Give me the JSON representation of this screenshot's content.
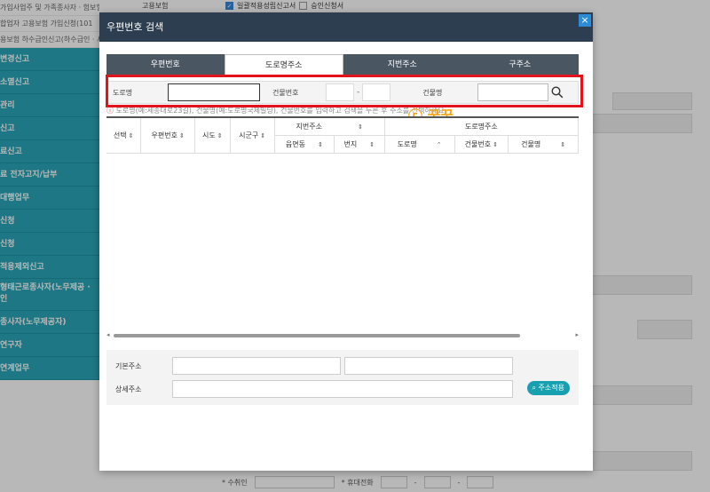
{
  "background": {
    "top_label": "고용보험",
    "checkbox1_label": "일괄적용성립신고서",
    "checkbox2_label": "승인신청서",
    "sidebar_subs": [
      "가입사업주 및 가족종사자 · 험보험가입신청(10108)",
      "합업자 고용보험 가입신청(101",
      "용보험 하수급인신고(하수급인 · 서)(10111)"
    ],
    "sidebar_items": [
      "변경신고",
      "소멸신고",
      "관리",
      "신고",
      "료신고",
      "료 전자고지/납부",
      "대행업무",
      "신청",
      "신청",
      "적용제외신고",
      "형태근로종사자(노무제공 · 인",
      "종사자(노무제공자)",
      "연구자",
      "연계업무"
    ],
    "bottom": {
      "label1": "* 수취인",
      "label2": "* 휴대전화",
      "dash": "-"
    }
  },
  "modal": {
    "title": "우편번호 검색",
    "close_icon": "×",
    "tabs": [
      "우편번호",
      "도로명주소",
      "지번주소",
      "구주소"
    ],
    "active_tab": 1,
    "search": {
      "road_label": "도로명",
      "road_value": "",
      "building_no_label": "건물번호",
      "dash": "-",
      "building_name_label": "건물명",
      "building_name_value": ""
    },
    "notice": "도로명(예:세종대로23길), 건물명(예:도로명국제빌딩), 건물번호를 입력하고 검색을 누른 후 주소를 선택하세요.",
    "watermark": "ⓒ 꿈꿈",
    "table": {
      "group_jibun": "지번주소",
      "group_road": "도로명주소",
      "columns": [
        "선택",
        "우편번호",
        "시도",
        "시군구",
        "읍면동",
        "번지",
        "도로명",
        "건물번호",
        "건물명"
      ]
    },
    "address": {
      "basic_label": "기본주소",
      "detail_label": "상세주소",
      "apply_button": "주소적용"
    }
  }
}
